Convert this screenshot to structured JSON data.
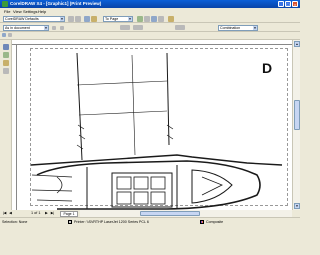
{
  "window": {
    "title": "CorelDRAW X4 - [Graphic1] (Print Preview)"
  },
  "menu": {
    "items": [
      "File",
      "View",
      "Settings",
      "Help"
    ]
  },
  "toolbar": {
    "print_style": "CorelDRAW Defaults",
    "page_select": "To Page",
    "as_in_document": "As in document",
    "combination": "Combination"
  },
  "page_nav": {
    "count_text": "1 of 1",
    "page_tab": "Page 1"
  },
  "status": {
    "selection": "Selection: None",
    "printer": "Printer: \\\\SVRTHP LaserJet 1200 Series PCL 6",
    "mode": "Composite"
  },
  "drawing": {
    "letter": "D"
  },
  "colors": {
    "titlebar": "#0a5fd8",
    "window_bg": "#ece9d8",
    "canvas_bg": "#ffffff",
    "line_art": "#1a1a1a"
  }
}
